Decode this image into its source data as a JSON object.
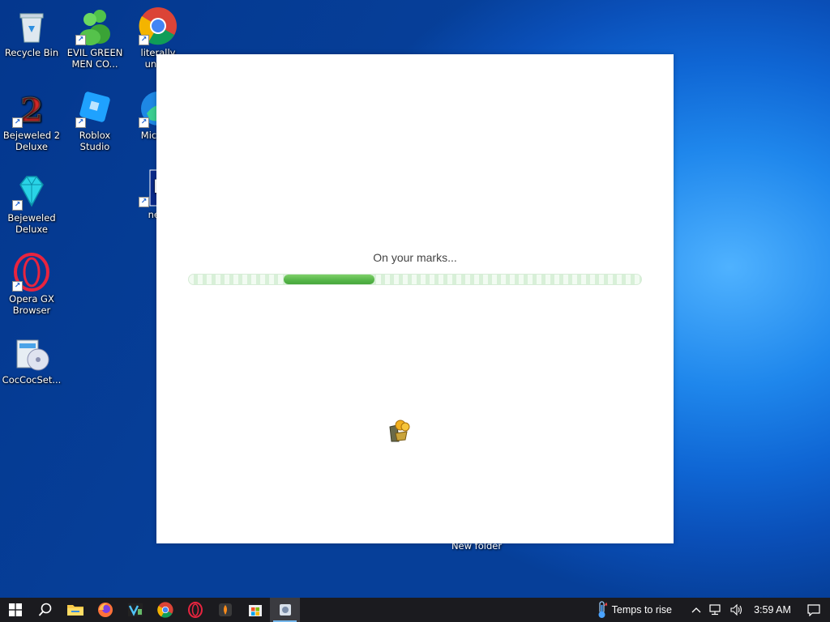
{
  "desktop": {
    "icons": [
      {
        "label": "Recycle Bin",
        "icon": "recycle-bin-icon"
      },
      {
        "label": "EVIL GREEN MEN CO...",
        "icon": "green-men-icon"
      },
      {
        "label": "literally unu...",
        "icon": "chrome-icon"
      },
      {
        "label": "Bejeweled 2 Deluxe",
        "icon": "bejeweled-2-icon"
      },
      {
        "label": "Roblox Studio",
        "icon": "roblox-studio-icon"
      },
      {
        "label": "Micr Ed",
        "icon": "edge-icon"
      },
      {
        "label": "Bejeweled Deluxe",
        "icon": "bejeweled-icon"
      },
      {
        "label": "nepl",
        "icon": "nepl-icon"
      },
      {
        "label": "Opera GX Browser",
        "icon": "opera-gx-icon"
      },
      {
        "label": "CocCocSet...",
        "icon": "coccoc-setup-icon"
      }
    ],
    "behind_window_label": "New folder"
  },
  "app": {
    "loading_text": "On your marks...",
    "progress": {
      "start": 0.21,
      "end": 0.41
    }
  },
  "taskbar": {
    "pinned": [
      "windows-start-icon",
      "search-icon",
      "file-explorer-icon",
      "firefox-icon",
      "vs-icon",
      "chrome-icon",
      "opera-gx-icon",
      "app-icon",
      "store-icon",
      "game-app-icon"
    ],
    "weather_text": "Temps to rise",
    "clock": "3:59 AM"
  },
  "colors": {
    "progress_fill": "#55b548",
    "taskbar": "#1b1b1f",
    "accent": "#76b9ed"
  }
}
